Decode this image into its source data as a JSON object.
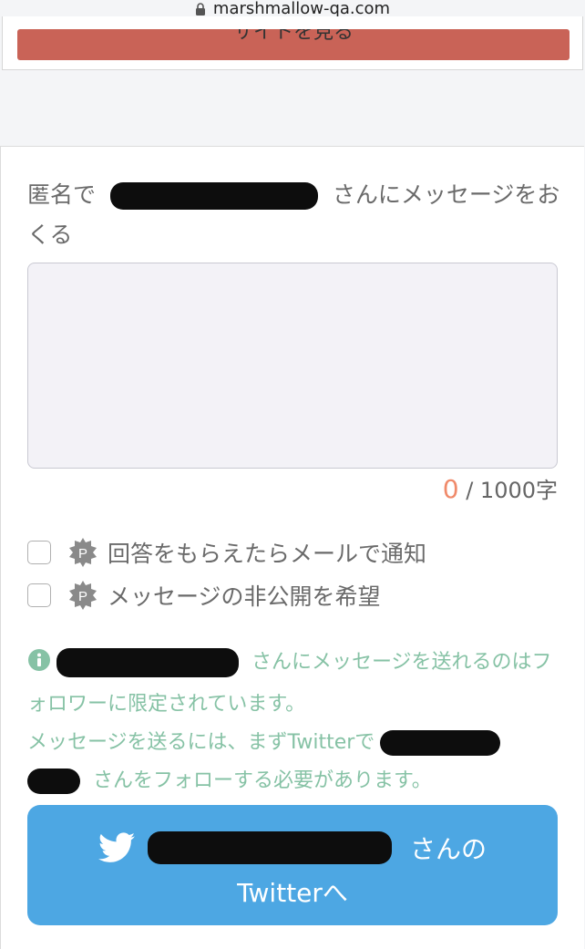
{
  "browser": {
    "url": "marshmallow-qa.com"
  },
  "top_button": {
    "label": "サイトを見る"
  },
  "form": {
    "heading_prefix": "匿名で",
    "heading_suffix": "さんにメッセージをおくる",
    "textarea_placeholder": "",
    "counter_current": "0",
    "counter_max": "/ 1000字"
  },
  "options": [
    {
      "label": "回答をもらえたらメール​で通知",
      "badge": "P",
      "checked": false
    },
    {
      "label": "メッセージの非公開を希望",
      "badge": "P",
      "checked": false
    }
  ],
  "notice": {
    "line1_suffix": "さんにメッセージを送れるのはフォロワーに限定されています。",
    "line2_prefix": "メッセージを送るには、まずTwitterで",
    "line2_suffix": "さんをフォローする必要があります。"
  },
  "twitter_button": {
    "suffix": "さんの",
    "line2": "Twitterへ"
  },
  "colors": {
    "accent_red": "#c96357",
    "twitter_blue": "#4da7e3",
    "notice_green": "#86c2a5",
    "counter_orange": "#f08a6a"
  }
}
